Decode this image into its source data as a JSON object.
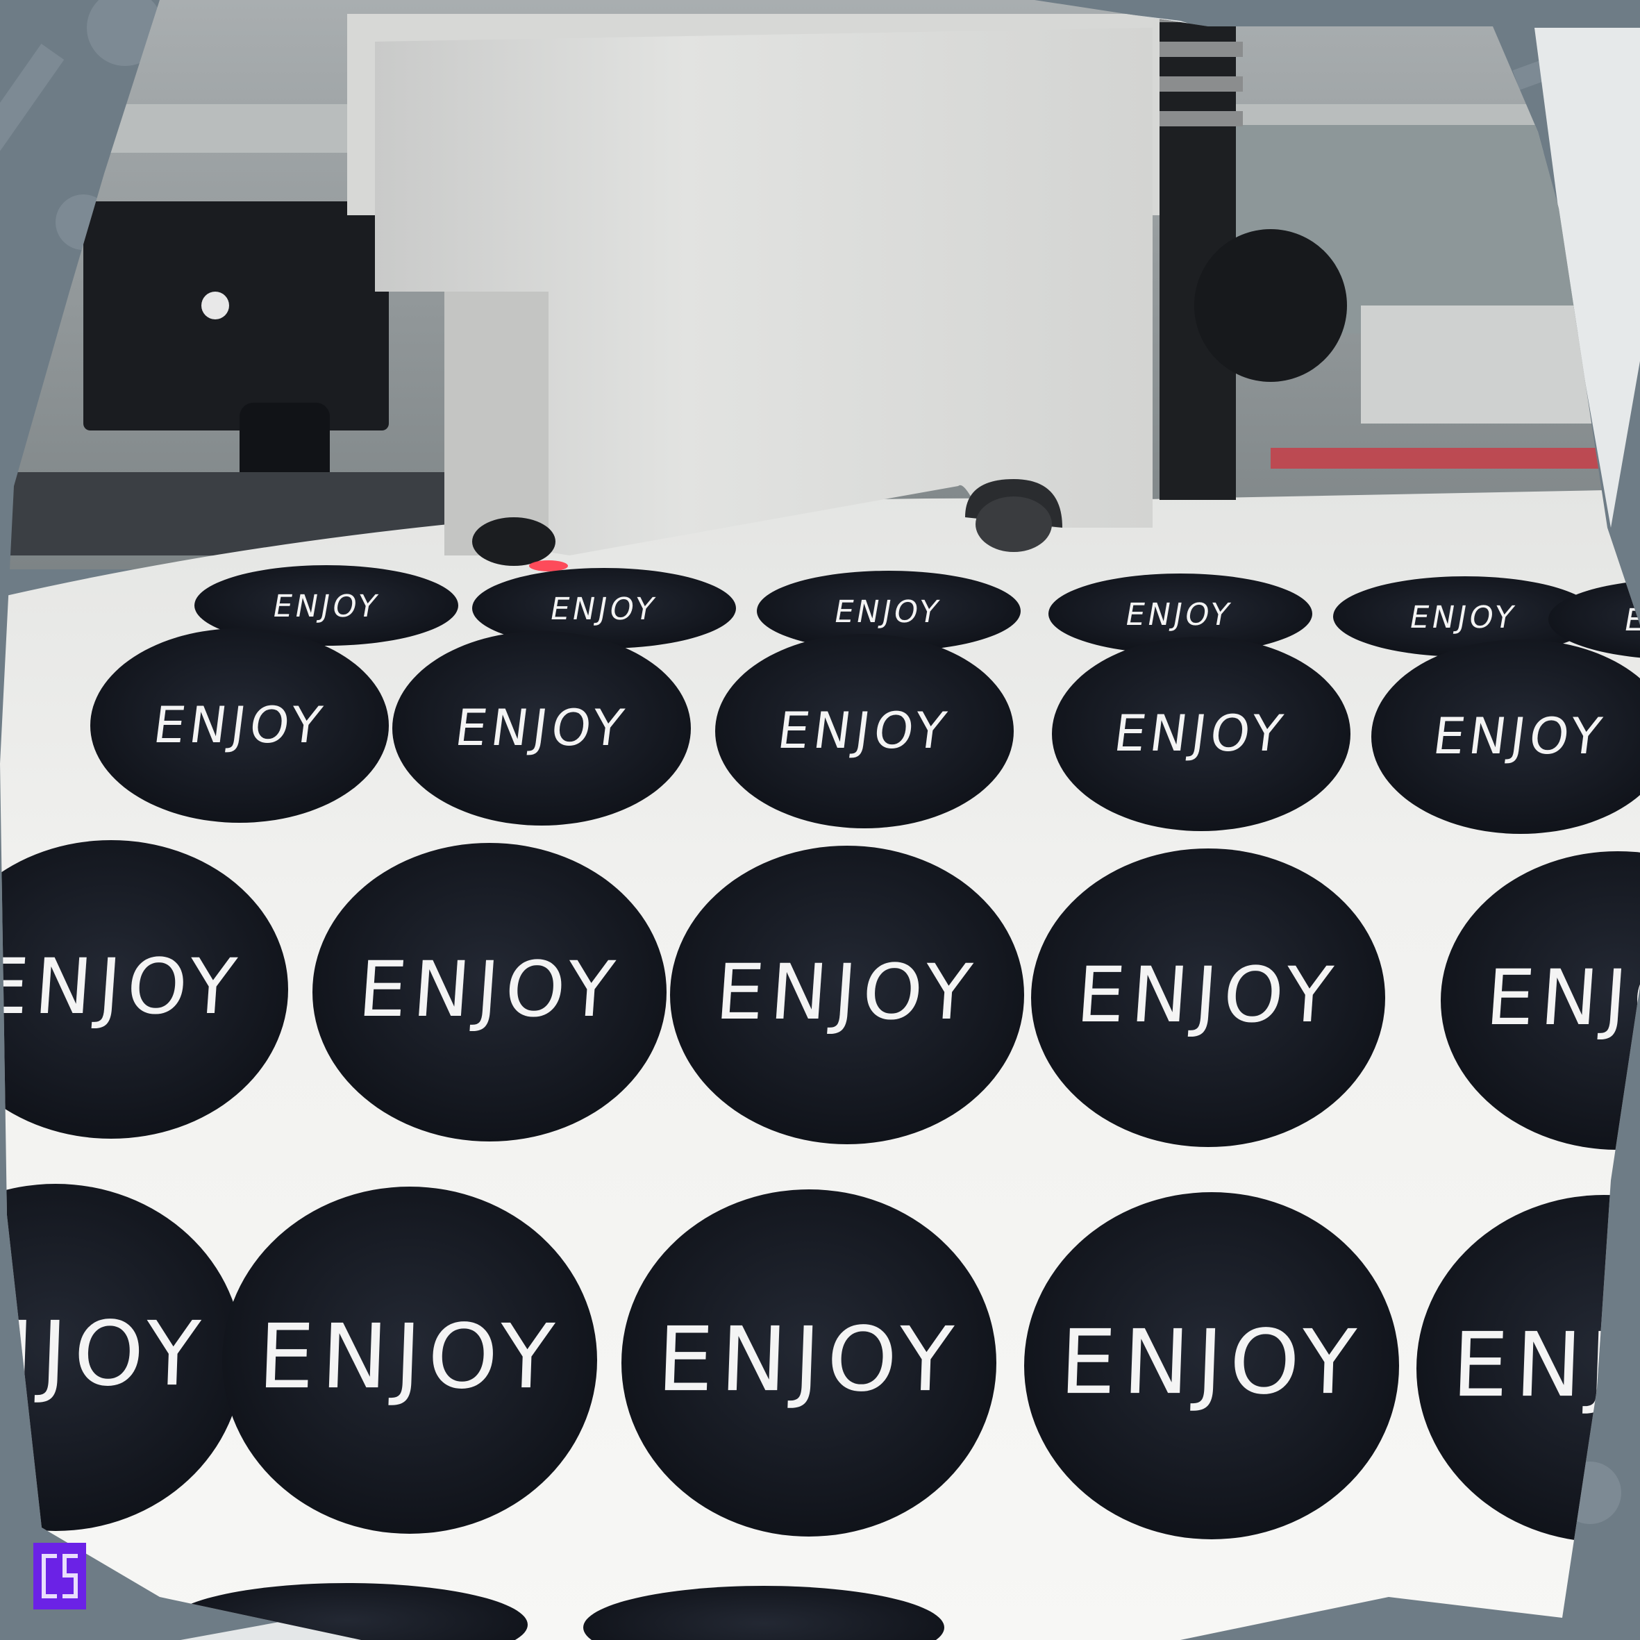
{
  "photo": {
    "subject": "vinyl cutter plotting round stickers",
    "sticker_text": "ENJOY",
    "colors": {
      "frame": "#6e7c86",
      "sticker": "#141821",
      "paper": "#ecedea",
      "machine": "#dcdddb",
      "laser": "#ff3a4a",
      "logo": "#6b22e6"
    }
  },
  "logo": {
    "icon": "brand-logo-icon"
  }
}
